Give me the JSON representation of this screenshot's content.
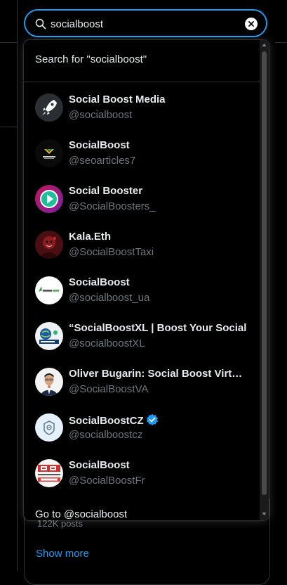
{
  "search": {
    "value": "socialboost",
    "search_for": "Search for \"socialboost\"",
    "goto": "Go to @socialboost"
  },
  "results": [
    {
      "name": "Social Boost Media",
      "handle": "@socialboost",
      "avatar": "rocket-avatar-icon"
    },
    {
      "name": "SocialBoost",
      "handle": "@seoarticles7",
      "avatar": "socialboost-logo-avatar-icon"
    },
    {
      "name": "Social Booster",
      "handle": "@SocialBoosters_",
      "avatar": "play-button-avatar-icon"
    },
    {
      "name": "Kala.Eth",
      "handle": "@SocialBoostTaxi",
      "avatar": "red-portrait-avatar-icon"
    },
    {
      "name": "SocialBoost",
      "handle": "@socialboost_ua",
      "avatar": "socialboost-text-avatar-icon"
    },
    {
      "name": "“SocialBoostXL | Boost Your Social",
      "handle": "@socialboostXL",
      "avatar": "globe-avatar-icon"
    },
    {
      "name": "Oliver Bugarin: Social Boost Virtual Assistant",
      "handle": "@SocialBoostVA",
      "avatar": "person-photo-avatar-icon"
    },
    {
      "name": "SocialBoostCZ",
      "handle": "@socialboostcz",
      "avatar": "shield-logo-avatar-icon",
      "verified": true
    },
    {
      "name": "SocialBoost",
      "handle": "@SocialBoostFr",
      "avatar": "sb-logo-avatar-icon"
    }
  ],
  "background": {
    "posts": "122K posts",
    "show_more": "Show more"
  },
  "colors": {
    "accent": "#1d9bf0",
    "text": "#e7e9ea",
    "muted": "#71767b",
    "background": "#000000"
  }
}
